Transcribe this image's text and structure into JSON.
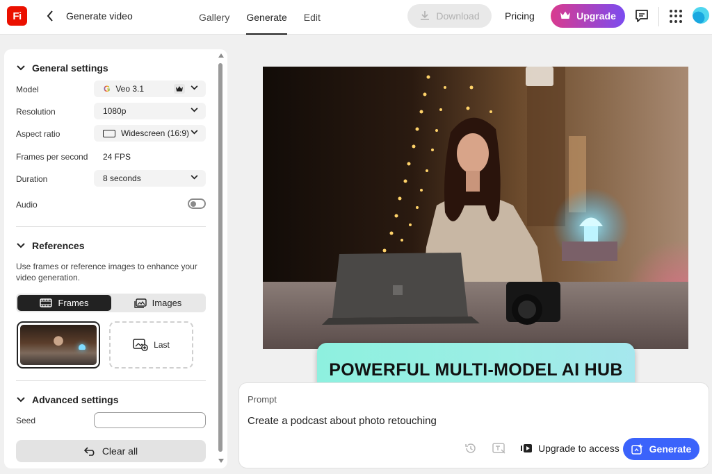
{
  "app": {
    "logo_text": "Fi",
    "title": "Generate video"
  },
  "nav": {
    "tabs": [
      {
        "label": "Gallery"
      },
      {
        "label": "Generate"
      },
      {
        "label": "Edit"
      }
    ],
    "active": "Generate"
  },
  "header": {
    "download_label": "Download",
    "pricing_label": "Pricing",
    "upgrade_label": "Upgrade"
  },
  "general": {
    "title": "General settings",
    "model": {
      "label": "Model",
      "value": "Veo 3.1"
    },
    "resolution": {
      "label": "Resolution",
      "value": "1080p"
    },
    "aspect": {
      "label": "Aspect ratio",
      "value": "Widescreen (16:9)"
    },
    "fps": {
      "label": "Frames per second",
      "value": "24 FPS"
    },
    "duration": {
      "label": "Duration",
      "value": "8 seconds"
    },
    "audio": {
      "label": "Audio",
      "enabled": false
    }
  },
  "references": {
    "title": "References",
    "description": "Use frames or reference images to enhance your video generation.",
    "tabs": {
      "frames": "Frames",
      "images": "Images"
    },
    "last_label": "Last"
  },
  "advanced": {
    "title": "Advanced settings",
    "seed_label": "Seed",
    "seed_value": ""
  },
  "clear_label": "Clear all",
  "banner_text": "POWERFUL MULTI-MODEL AI HUB",
  "prompt": {
    "label": "Prompt",
    "text": "Create a podcast about photo retouching",
    "upgrade_label": "Upgrade to access",
    "generate_label": "Generate"
  },
  "colors": {
    "accent": "#3b63fb",
    "brand": "#eb1000",
    "upgrade_gradient_start": "#d93a8e",
    "upgrade_gradient_end": "#7b4cf0"
  }
}
